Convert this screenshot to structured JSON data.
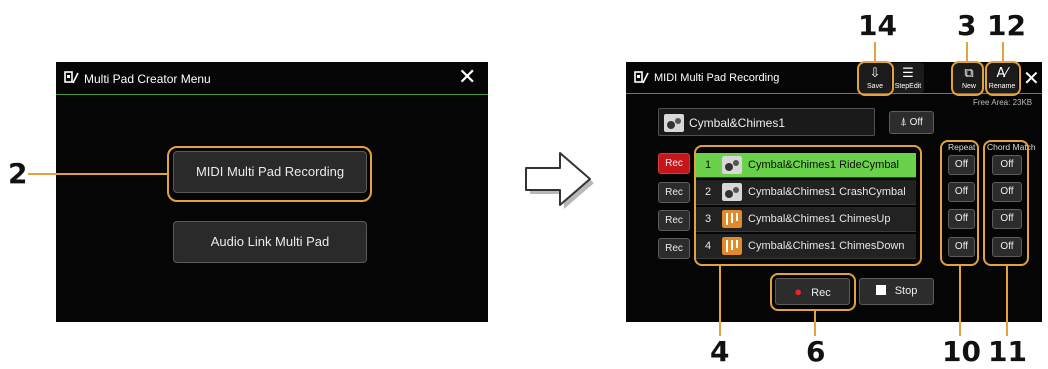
{
  "callouts": [
    "14",
    "3",
    "12",
    "2",
    "4",
    "6",
    "10",
    "11"
  ],
  "creator_menu": {
    "title": "Multi Pad Creator Menu",
    "buttons": [
      "MIDI Multi Pad Recording",
      "Audio Link Multi Pad"
    ]
  },
  "recording": {
    "title": "MIDI Multi Pad Recording",
    "toolbar": [
      {
        "label": "Save",
        "icon": "save-icon"
      },
      {
        "label": "StepEdit",
        "icon": "step-edit-icon"
      },
      {
        "label": "New",
        "icon": "new-icon"
      },
      {
        "label": "Rename",
        "icon": "rename-icon"
      }
    ],
    "free_area": "Free Area:  23KB",
    "bank_name": "Cymbal&Chimes1",
    "metronome": "Off",
    "column_headers": {
      "repeat": "Repeat",
      "chord_match": "Chord Match"
    },
    "pads": [
      {
        "rec": "Rec",
        "num": "1",
        "name": "Cymbal&Chimes1 RideCymbal",
        "repeat": "Off",
        "chord_match": "Off",
        "selected": true
      },
      {
        "rec": "Rec",
        "num": "2",
        "name": "Cymbal&Chimes1 CrashCymbal",
        "repeat": "Off",
        "chord_match": "Off",
        "selected": false
      },
      {
        "rec": "Rec",
        "num": "3",
        "name": "Cymbal&Chimes1 ChimesUp",
        "repeat": "Off",
        "chord_match": "Off",
        "selected": false
      },
      {
        "rec": "Rec",
        "num": "4",
        "name": "Cymbal&Chimes1 ChimesDown",
        "repeat": "Off",
        "chord_match": "Off",
        "selected": false
      }
    ],
    "transport": {
      "rec": "Rec",
      "stop": "Stop"
    }
  },
  "colors": {
    "accent": "#e2a33a",
    "selected_row": "#6ad24a",
    "rec_red": "#c7161a",
    "title_rule": "#3f9a3a"
  }
}
